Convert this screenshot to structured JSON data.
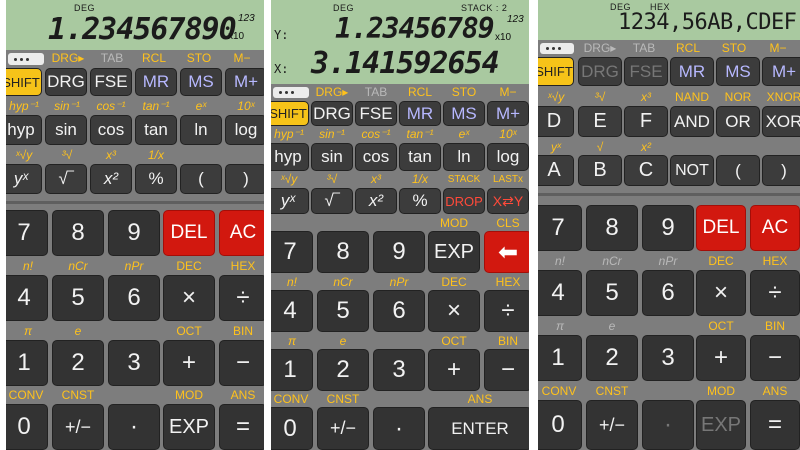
{
  "screens": [
    {
      "display": {
        "mode": "DEG",
        "number": "1.234567890",
        "exp": "123",
        "x10": "x10"
      },
      "toprow": [
        "DRG▸",
        "TAB",
        "RCL",
        "STO",
        "M−"
      ],
      "row1": [
        "SHIFT",
        "DRG",
        "FSE",
        "MR",
        "MS",
        "M+"
      ],
      "row2_labels": [
        "hyp⁻¹",
        "sin⁻¹",
        "cos⁻¹",
        "tan⁻¹",
        "eˣ",
        "10ˣ"
      ],
      "row2": [
        "hyp",
        "sin",
        "cos",
        "tan",
        "ln",
        "log"
      ],
      "row3_labels": [
        "ˣ√y",
        "³√",
        "x³",
        "1/x"
      ],
      "row3": [
        "yˣ",
        "√‾",
        "x²",
        "%",
        "(",
        ")"
      ],
      "rowA": [
        "7",
        "8",
        "9",
        "DEL",
        "AC"
      ],
      "rowB_labels": [
        "n!",
        "nCr",
        "nPr",
        "DEC",
        "HEX"
      ],
      "rowB": [
        "4",
        "5",
        "6",
        "×",
        "÷"
      ],
      "rowC_labels": [
        "π",
        "e",
        "OCT",
        "BIN"
      ],
      "rowC": [
        "1",
        "2",
        "3",
        "+",
        "−"
      ],
      "rowD_labels": [
        "CONV",
        "CNST",
        "MOD",
        "ANS"
      ],
      "rowD": [
        "0",
        "+/−",
        "·",
        "EXP",
        "="
      ]
    },
    {
      "display": {
        "mode": "DEG",
        "stack": "STACK : 2",
        "y_label": "Y:",
        "x_label": "X:",
        "y_value": "1.23456789",
        "x_value": "3.141592654",
        "exp": "123",
        "x10": "x10"
      },
      "toprow": [
        "DRG▸",
        "TAB",
        "RCL",
        "STO",
        "M−"
      ],
      "row1": [
        "SHIFT",
        "DRG",
        "FSE",
        "MR",
        "MS",
        "M+"
      ],
      "row2_labels": [
        "hyp⁻¹",
        "sin⁻¹",
        "cos⁻¹",
        "tan⁻¹",
        "eˣ",
        "10ˣ"
      ],
      "row2": [
        "hyp",
        "sin",
        "cos",
        "tan",
        "ln",
        "log"
      ],
      "row3_labels": [
        "ˣ√y",
        "³√",
        "x³",
        "1/x",
        "STACK",
        "LASTx"
      ],
      "row3": [
        "yˣ",
        "√‾",
        "x²",
        "%",
        "DROP",
        "X⇄Y"
      ],
      "rowA_labels": [
        "MOD",
        "CLS"
      ],
      "rowA": [
        "7",
        "8",
        "9",
        "EXP",
        "⬅"
      ],
      "rowB_labels": [
        "n!",
        "nCr",
        "nPr",
        "DEC",
        "HEX"
      ],
      "rowB": [
        "4",
        "5",
        "6",
        "×",
        "÷"
      ],
      "rowC_labels": [
        "π",
        "e",
        "OCT",
        "BIN"
      ],
      "rowC": [
        "1",
        "2",
        "3",
        "+",
        "−"
      ],
      "rowD_labels": [
        "CONV",
        "CNST",
        "ANS"
      ],
      "rowD": [
        "0",
        "+/−",
        "·",
        "ENTER"
      ]
    },
    {
      "display": {
        "mode": "DEG",
        "base": "HEX",
        "number": "1234,56AB,CDEF"
      },
      "toprow": [
        "DRG▸",
        "TAB",
        "RCL",
        "STO",
        "M−"
      ],
      "row1": [
        "SHIFT",
        "DRG",
        "FSE",
        "MR",
        "MS",
        "M+"
      ],
      "row2_labels": [
        "ˣ√y",
        "³√",
        "x³",
        "NAND",
        "NOR",
        "XNOR"
      ],
      "row2": [
        "D",
        "E",
        "F",
        "AND",
        "OR",
        "XOR"
      ],
      "row3_labels": [
        "yˣ",
        "√",
        "x²"
      ],
      "row3": [
        "A",
        "B",
        "C",
        "NOT",
        "(",
        ")"
      ],
      "rowA": [
        "7",
        "8",
        "9",
        "DEL",
        "AC"
      ],
      "rowB_labels": [
        "n!",
        "nCr",
        "nPr",
        "DEC",
        "HEX"
      ],
      "rowB": [
        "4",
        "5",
        "6",
        "×",
        "÷"
      ],
      "rowC_labels": [
        "π",
        "e",
        "OCT",
        "BIN"
      ],
      "rowC": [
        "1",
        "2",
        "3",
        "+",
        "−"
      ],
      "rowD_labels": [
        "CONV",
        "CNST",
        "MOD",
        "ANS"
      ],
      "rowD": [
        "0",
        "+/−",
        "·",
        "EXP",
        "="
      ]
    }
  ]
}
